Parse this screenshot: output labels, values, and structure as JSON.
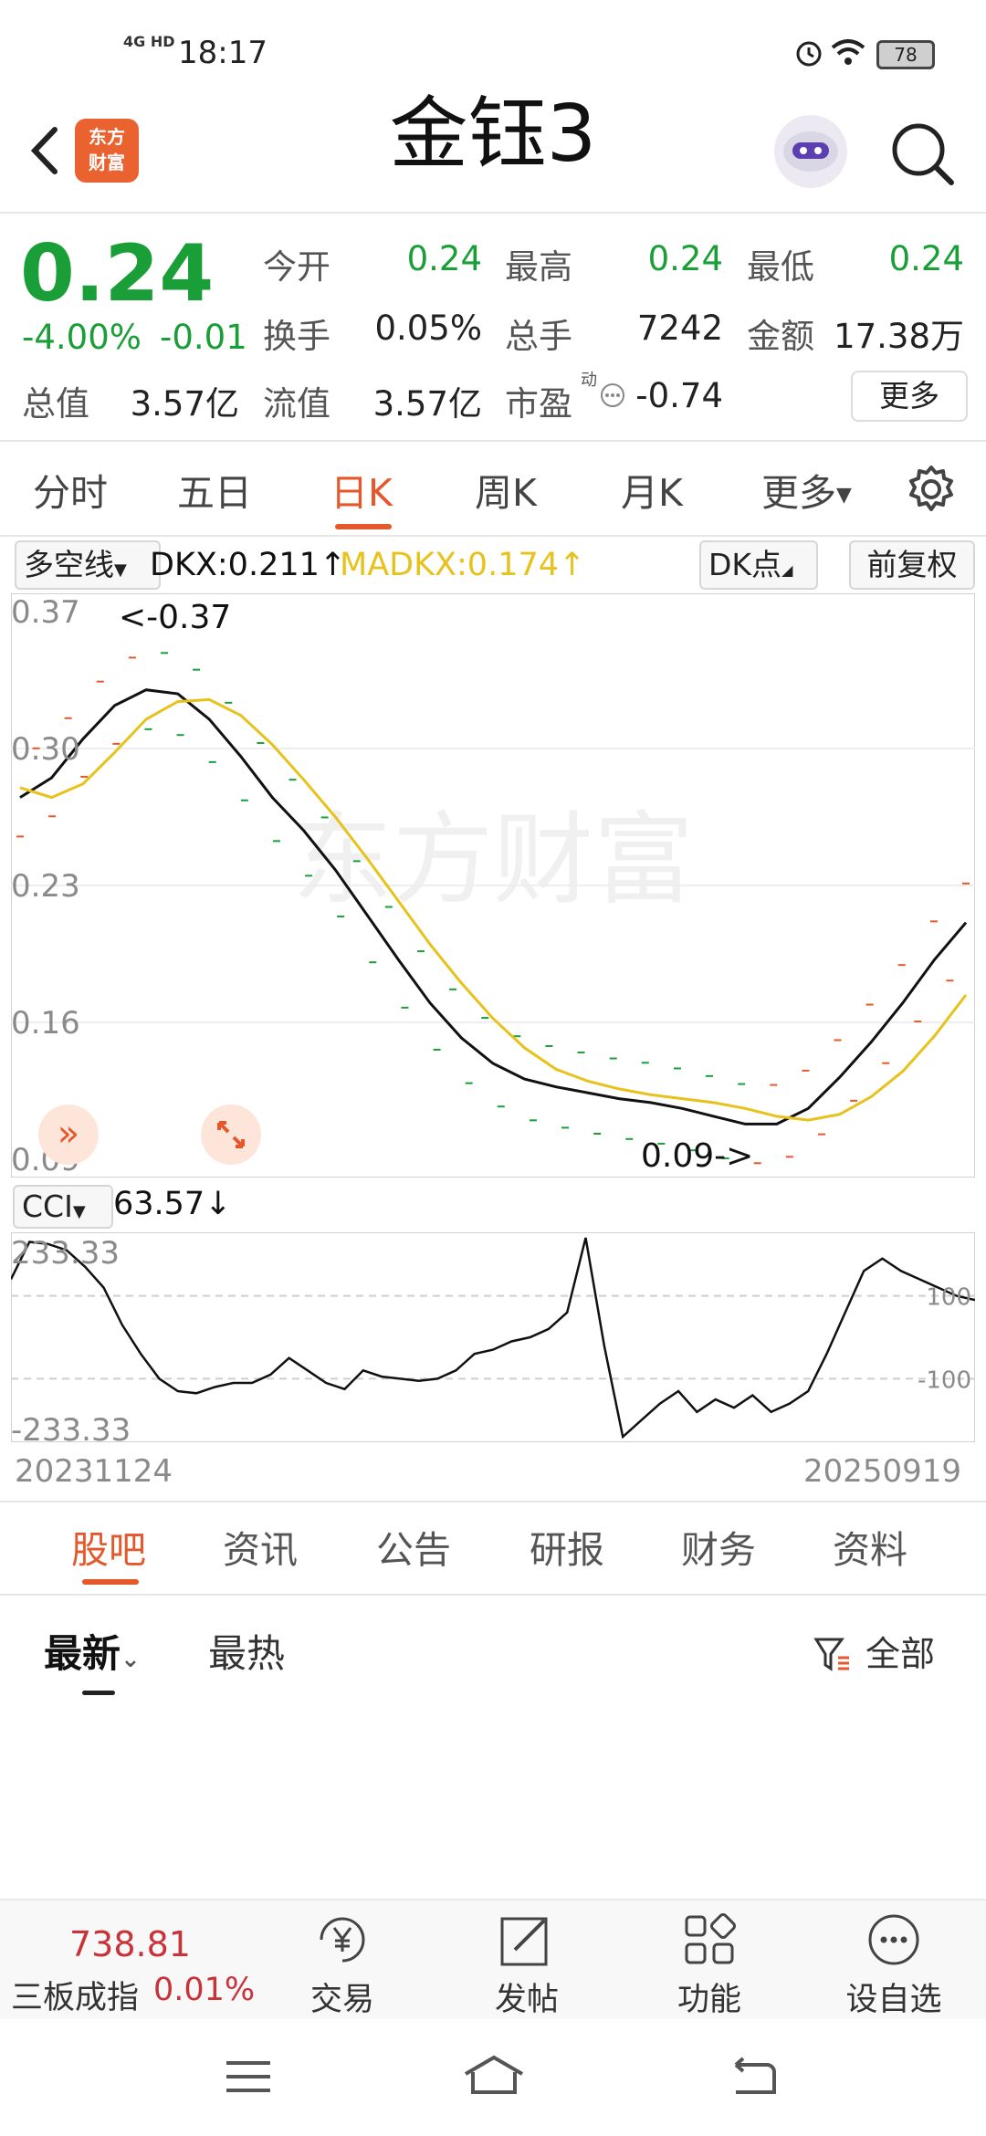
{
  "status_bar": {
    "network": "4G HD",
    "time": "18:17",
    "battery": "78"
  },
  "header": {
    "title": "金钰3",
    "logo_line1": "东方",
    "logo_line2": "财富"
  },
  "quote": {
    "price": "0.24",
    "change_pct": "-4.00%",
    "change": "-0.01",
    "open_label": "今开",
    "open": "0.24",
    "high_label": "最高",
    "high": "0.24",
    "low_label": "最低",
    "low": "0.24",
    "turnover_label": "换手",
    "turnover": "0.05%",
    "volume_label": "总手",
    "volume": "7242",
    "amount_label": "金额",
    "amount": "17.38万",
    "mktcap_label": "总值",
    "mktcap": "3.57亿",
    "float_label": "流值",
    "float": "3.57亿",
    "pe_label": "市盈",
    "pe_sup": "动",
    "pe": "-0.74",
    "more": "更多"
  },
  "chart_tabs": [
    "分时",
    "五日",
    "日K",
    "周K",
    "月K",
    "更多"
  ],
  "chart_controls": {
    "indicator_select": "多空线",
    "dkx": "DKX:0.211↑",
    "madkx": "MADKX:0.174↑",
    "dk_button": "DK点",
    "adjust_button": "前复权",
    "cci_select": "CCI",
    "cci_value": "63.57↓"
  },
  "colors": {
    "up": "#e4582b",
    "down": "#1a9e37",
    "dkx": "#111111",
    "madkx": "#e8c21c"
  },
  "chart_data": [
    {
      "type": "line",
      "panel": "main",
      "y_ticks": [
        "0.37",
        "0.30",
        "0.23",
        "0.16",
        "0.09"
      ],
      "ylim": [
        0.09,
        0.37
      ],
      "annotations": [
        "<-0.37",
        "0.09->"
      ],
      "watermark": "东方财富",
      "x": [
        0,
        1,
        2,
        3,
        4,
        5,
        6,
        7,
        8,
        9,
        10,
        11,
        12,
        13,
        14,
        15,
        16,
        17,
        18,
        19,
        20,
        21,
        22,
        23,
        24,
        25,
        26,
        27,
        28,
        29,
        30
      ],
      "series": [
        {
          "name": "DKX",
          "values": [
            0.275,
            0.285,
            0.305,
            0.322,
            0.33,
            0.328,
            0.315,
            0.296,
            0.275,
            0.258,
            0.238,
            0.215,
            0.192,
            0.17,
            0.152,
            0.139,
            0.131,
            0.127,
            0.124,
            0.121,
            0.119,
            0.116,
            0.112,
            0.108,
            0.108,
            0.116,
            0.132,
            0.15,
            0.17,
            0.192,
            0.211
          ]
        },
        {
          "name": "MADKX",
          "values": [
            0.28,
            0.275,
            0.282,
            0.298,
            0.315,
            0.324,
            0.325,
            0.317,
            0.302,
            0.284,
            0.265,
            0.244,
            0.222,
            0.2,
            0.18,
            0.162,
            0.147,
            0.136,
            0.13,
            0.126,
            0.123,
            0.121,
            0.119,
            0.116,
            0.112,
            0.11,
            0.113,
            0.122,
            0.135,
            0.153,
            0.174
          ]
        }
      ]
    },
    {
      "type": "line",
      "panel": "CCI",
      "y_ticks": [
        "233.33",
        "100",
        "-100",
        "-233.33"
      ],
      "ylim": [
        -240,
        240
      ],
      "x_labels": [
        "20231124",
        "20250919"
      ],
      "series": [
        {
          "name": "CCI",
          "values": [
            140,
            230,
            225,
            210,
            170,
            120,
            30,
            -40,
            -100,
            -130,
            -135,
            -120,
            -110,
            -110,
            -90,
            -50,
            -80,
            -110,
            -125,
            -80,
            -95,
            -100,
            -105,
            -100,
            -80,
            -40,
            -30,
            -10,
            0,
            20,
            60,
            240,
            -20,
            -240,
            -200,
            -160,
            -130,
            -180,
            -150,
            -170,
            -140,
            -180,
            -160,
            -130,
            -40,
            60,
            160,
            190,
            160,
            140,
            120,
            100,
            90
          ]
        }
      ]
    }
  ],
  "content_tabs": [
    "股吧",
    "资讯",
    "公告",
    "研报",
    "财务",
    "资料"
  ],
  "sub_tabs": {
    "latest": "最新",
    "hot": "最热",
    "filter": "全部"
  },
  "bottom_bar": {
    "index_value": "738.81",
    "index_name": "三板成指",
    "index_change": "0.01%",
    "trade": "交易",
    "post": "发帖",
    "function": "功能",
    "watchlist": "设自选"
  }
}
